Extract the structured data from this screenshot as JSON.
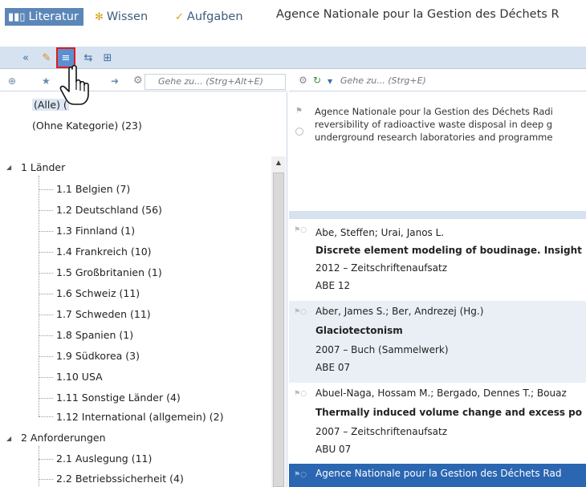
{
  "tabs": [
    {
      "label": "Literatur",
      "icon": "books-icon",
      "active": true
    },
    {
      "label": "Wissen",
      "icon": "knowledge-icon",
      "active": false
    },
    {
      "label": "Aufgaben",
      "icon": "tasks-icon",
      "active": false
    }
  ],
  "doc_title": "Agence Nationale pour la Gestion des Déchets R",
  "left_search_placeholder": "Gehe zu... (Strg+Alt+E)",
  "right_search_placeholder": "Gehe zu... (Strg+E)",
  "categories_top": [
    {
      "label": "(Alle) (",
      "selected": true
    },
    {
      "label": "(Ohne Kategorie) (23)",
      "selected": false
    }
  ],
  "tree": [
    {
      "label": "1 Länder",
      "children": [
        "1.1 Belgien (7)",
        "1.2 Deutschland (56)",
        "1.3 Finnland (1)",
        "1.4 Frankreich (10)",
        "1.5 Großbritanien (1)",
        "1.6 Schweiz (11)",
        "1.7 Schweden (11)",
        "1.8 Spanien (1)",
        "1.9 Südkorea (3)",
        "1.10 USA",
        "1.11 Sonstige Länder (4)",
        "1.12 International (allgemein) (2)"
      ]
    },
    {
      "label": "2 Anforderungen",
      "children": [
        "2.1 Auslegung (11)",
        "2.2 Betriebssicherheit (4)"
      ]
    }
  ],
  "preview_lines": [
    "Agence Nationale pour la Gestion des Déchets Radi",
    "reversibility of radioactive waste disposal in deep g",
    "underground research laboratories and programme"
  ],
  "references": [
    {
      "authors": "Abe, Steffen; Urai, Janos L.",
      "title": "Discrete element modeling of boudinage. Insight",
      "meta": "2012 – Zeitschriftenaufsatz",
      "key": "ABE 12",
      "style": "plain"
    },
    {
      "authors": "Aber, James S.; Ber, Andrezej (Hg.)",
      "title": "Glaciotectonism",
      "meta": "2007 – Buch (Sammelwerk)",
      "key": "ABE 07",
      "style": "alt"
    },
    {
      "authors": "Abuel-Naga, Hossam M.; Bergado, Dennes T.; Bouaz",
      "title": "Thermally induced volume change and excess po",
      "meta": "2007 – Zeitschriftenaufsatz",
      "key": "ABU 07",
      "style": "plain"
    },
    {
      "authors": "Agence Nationale pour la Gestion des Déchets Rad",
      "title": "",
      "meta": "",
      "key": "",
      "style": "sel"
    }
  ]
}
